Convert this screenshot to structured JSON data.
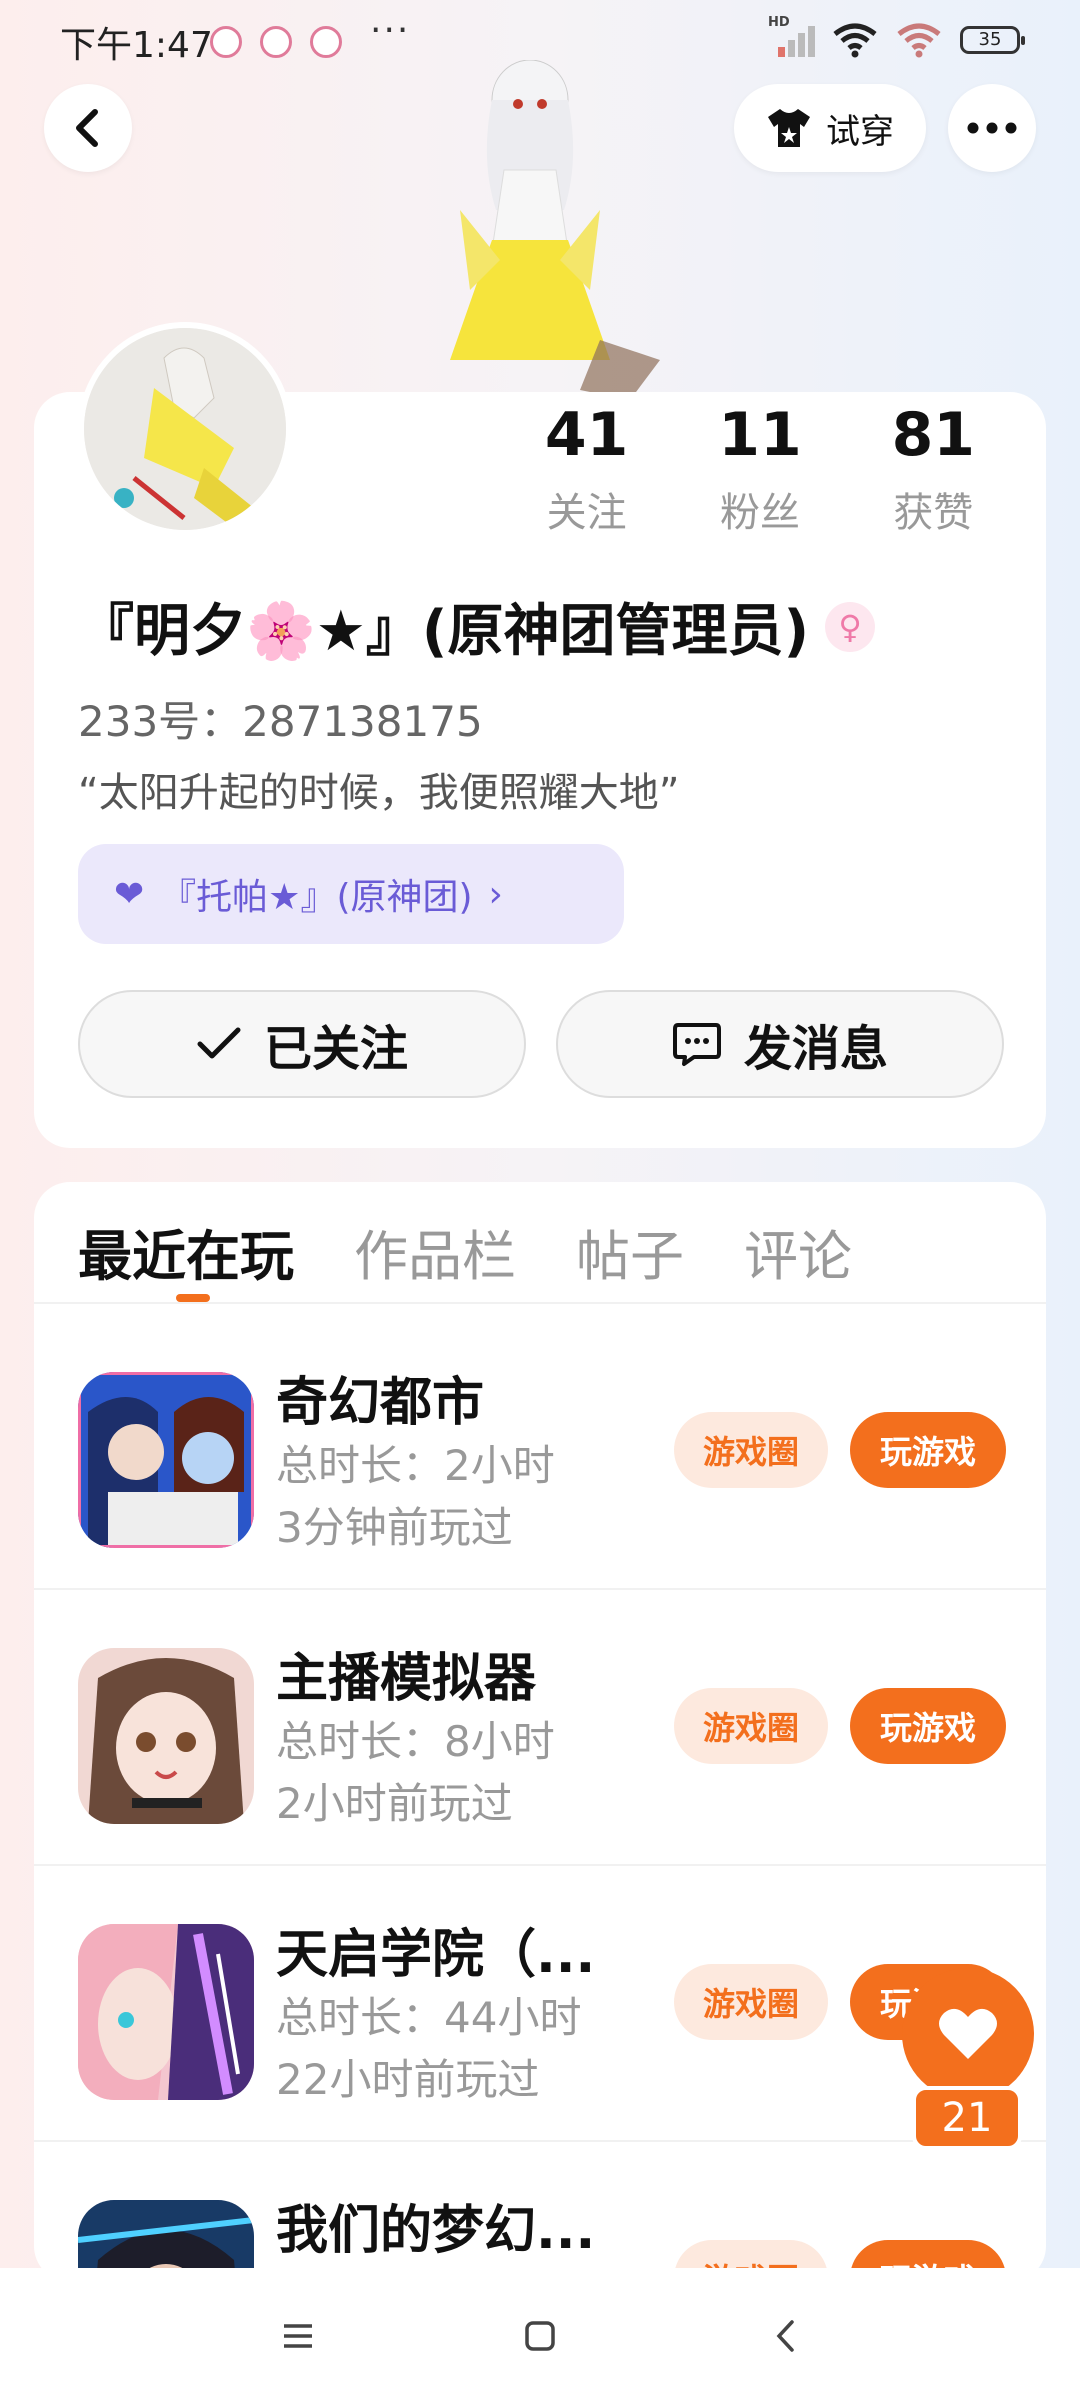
{
  "status_bar": {
    "time": "下午1:47",
    "dots": "···",
    "network_label": "HD",
    "battery": "35"
  },
  "top_nav": {
    "tryon_label": "试穿"
  },
  "profile": {
    "stats": [
      {
        "value": "41",
        "label": "关注"
      },
      {
        "value": "11",
        "label": "粉丝"
      },
      {
        "value": "81",
        "label": "获赞"
      }
    ],
    "username": "『明夕🌸★』(原神团管理员)",
    "uid": "233号：287138175",
    "bio": "“太阳升起的时候，我便照耀大地”",
    "group_label": "『托帕★』(原神团)",
    "group_arrow": "›",
    "follow_label": "已关注",
    "message_label": "发消息"
  },
  "tabs": [
    "最近在玩",
    "作品栏",
    "帖子",
    "评论"
  ],
  "games": [
    {
      "title": "奇幻都市",
      "duration": "总时长：2小时",
      "last_played": "3分钟前玩过",
      "circle_label": "游戏圈",
      "play_label": "玩游戏"
    },
    {
      "title": "主播模拟器",
      "duration": "总时长：8小时",
      "last_played": "2小时前玩过",
      "circle_label": "游戏圈",
      "play_label": "玩游戏"
    },
    {
      "title": "天启学院（...",
      "duration": "总时长：44小时",
      "last_played": "22小时前玩过",
      "circle_label": "游戏圈",
      "play_label": "玩游戏"
    },
    {
      "title": "我们的梦幻...",
      "duration": "",
      "last_played": "",
      "circle_label": "游戏圈",
      "play_label": "玩游戏"
    }
  ],
  "like_float": {
    "count": "21"
  },
  "colors": {
    "accent": "#f36f1d",
    "group_purple": "#6a5bd6"
  }
}
